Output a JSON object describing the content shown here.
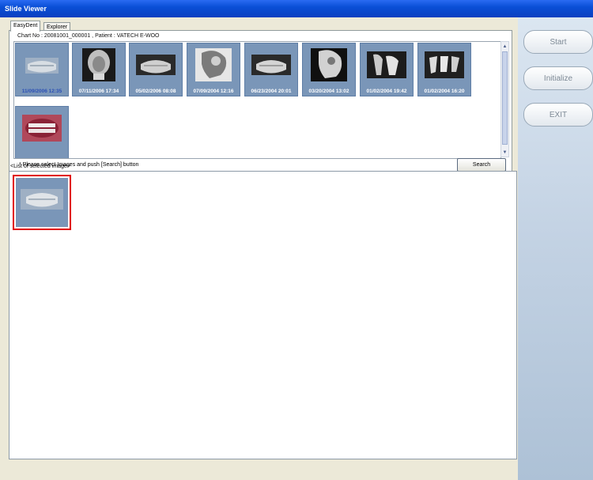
{
  "window": {
    "title": "Slide Viewer"
  },
  "tabs": [
    {
      "label": "EasyDent",
      "active": true
    },
    {
      "label": "Explorer",
      "active": false
    }
  ],
  "chart_info": "Chart No : 20081001_000001 , Patient : VATECH E-WOO",
  "thumbnails": [
    {
      "caption": "11/09/2006 12:35",
      "icon": "panoramic-xray-icon",
      "selected": true
    },
    {
      "caption": "07/11/2006 17:34",
      "icon": "ap-skull-xray-icon",
      "selected": false
    },
    {
      "caption": "05/02/2006 08:08",
      "icon": "panoramic-xray-icon",
      "selected": false
    },
    {
      "caption": "07/09/2004 12:16",
      "icon": "lateral-ceph-xray-icon",
      "selected": false
    },
    {
      "caption": "06/23/2004 20:01",
      "icon": "panoramic-xray-icon",
      "selected": false
    },
    {
      "caption": "03/20/2004 13:02",
      "icon": "lateral-ceph-xray-icon",
      "selected": false
    },
    {
      "caption": "01/02/2004 19:42",
      "icon": "periapical-xray-icon",
      "selected": false
    },
    {
      "caption": "01/02/2004 16:20",
      "icon": "periapical-xray-icon",
      "selected": false
    },
    {
      "caption": "",
      "icon": "intraoral-photo-icon",
      "selected": false
    }
  ],
  "instruction": "* Please select Images and push [Search] button",
  "search_button": "Search",
  "selected_list": {
    "label": "<List of selected image>",
    "items": [
      {
        "icon": "panoramic-xray-icon"
      }
    ]
  },
  "side_buttons": {
    "start": "Start",
    "initialize": "Initialize",
    "exit": "EXIT"
  },
  "colors": {
    "title_bar": "#0a4fd6",
    "thumb_bg": "#7a96b8",
    "selection_border": "#e00000",
    "side_panel": "#c4d3e4"
  }
}
